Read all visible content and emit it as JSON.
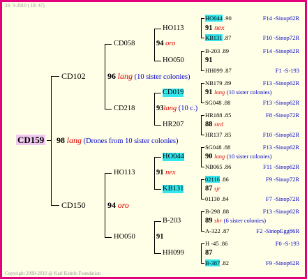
{
  "header": "28- 9-2010 ( 18: 47)",
  "footer": "Copyright 2008-2010 @ Karl Kehrle Foundation",
  "root": {
    "id": "CD159",
    "num": "98",
    "tag": "lang",
    "note": "(Drones from 10 sister colonies)"
  },
  "gen1": [
    {
      "id": "CD102",
      "num": "96",
      "tag": "lang",
      "note": "(10 sister colonies)"
    },
    {
      "id": "CD150",
      "num": "94",
      "tag": "oro",
      "note": ""
    }
  ],
  "gen2": [
    {
      "id": "CD058",
      "num": "94",
      "tag": "oro",
      "note": ""
    },
    {
      "id": "CD218",
      "num": "93",
      "tag": "lang",
      "note": "(10 c.)"
    },
    {
      "id": "HO113",
      "num": "91",
      "tag": "nex",
      "note": ""
    },
    {
      "id": "HO050",
      "num": "91",
      "tag": "",
      "note": ""
    }
  ],
  "gen3": [
    {
      "id": "HO113",
      "num": "91",
      "tag": "nex",
      "note": ""
    },
    {
      "id": "HO050",
      "num": "91",
      "tag": "",
      "note": ""
    },
    {
      "id": "CD019",
      "num": "91",
      "tag": "lang",
      "note": "(10 sister colonies)"
    },
    {
      "id": "HR207",
      "num": "88",
      "tag": "strd",
      "note": ""
    },
    {
      "id": "HO044",
      "num": "90",
      "tag": "lang",
      "note": "(10 sister colonies)"
    },
    {
      "id": "KB131",
      "num": "87",
      "tag": "sjr",
      "note": ""
    },
    {
      "id": "B-203",
      "num": "89",
      "tag": "shr",
      "note": "(6 sister colonies)"
    },
    {
      "id": "HH099",
      "num": "87",
      "tag": "",
      "note": ""
    }
  ],
  "gen4": [
    {
      "id": "HO044",
      "val": ".90",
      "ref": "F14 -Sinop62R"
    },
    {
      "id": "KB131",
      "val": ".87",
      "ref": "F10 -Sinop72R"
    },
    {
      "id": "B-203",
      "val": ".89",
      "ref": "F14 -Sinop62R"
    },
    {
      "id": "HH099",
      "val": ".87",
      "ref": "F1 -S-193"
    },
    {
      "id": "NB179",
      "val": ".89",
      "ref": "F13 -Sinop62R"
    },
    {
      "id": "SG048",
      "val": ".88",
      "ref": "F13 -Sinop62R"
    },
    {
      "id": "HR188",
      "val": ".85",
      "ref": "F8 -Sinop72R"
    },
    {
      "id": "HR137",
      "val": ".85",
      "ref": "F10 -Sinop62R"
    },
    {
      "id": "SG048",
      "val": ".88",
      "ref": "F13 -Sinop62R"
    },
    {
      "id": "NB065",
      "val": ".86",
      "ref": "F11 -Sinop62R"
    },
    {
      "id": "02116",
      "val": ".86",
      "ref": "F9 -Sinop72R"
    },
    {
      "id": "01130",
      "val": ".84",
      "ref": "F7 -Sinop72R"
    },
    {
      "id": "B-298",
      "val": ".88",
      "ref": "F13 -Sinop62R"
    },
    {
      "id": "A-322",
      "val": ".87",
      "ref": "F2 -SinopEgg86R"
    },
    {
      "id": "H -45",
      "val": ".86",
      "ref": "F0 -S-193"
    },
    {
      "id": "B-387",
      "val": ".82",
      "ref": "F9 -Sinop62R"
    }
  ]
}
